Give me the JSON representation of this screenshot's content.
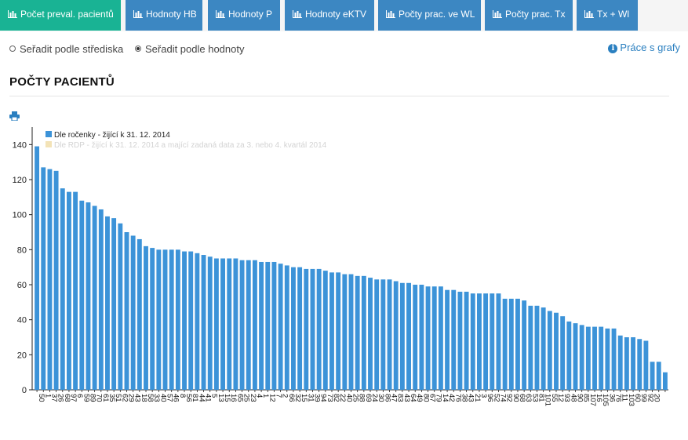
{
  "tabs": [
    {
      "label": "Počet preval. pacientů",
      "active": true,
      "icon": "bar-chart-icon"
    },
    {
      "label": "Hodnoty HB",
      "active": false,
      "icon": "bar-chart-icon"
    },
    {
      "label": "Hodnoty P",
      "active": false,
      "icon": "bar-chart-icon"
    },
    {
      "label": "Hodnoty eKTV",
      "active": false,
      "icon": "bar-chart-icon"
    },
    {
      "label": "Počty prac. ve WL",
      "active": false,
      "icon": "bar-chart-icon"
    },
    {
      "label": "Počty prac. Tx",
      "active": false,
      "icon": "bar-chart-icon"
    },
    {
      "label": "Tx + Wl",
      "active": false,
      "icon": "bar-chart-icon"
    }
  ],
  "sort": {
    "options": [
      {
        "label": "Seřadit podle střediska",
        "selected": false
      },
      {
        "label": "Seřadit podle hodnoty",
        "selected": true
      }
    ]
  },
  "help": {
    "label": "Práce s grafy",
    "icon": "info-icon"
  },
  "page_title": "POČTY PACIENTŮ",
  "print_icon": "printer-icon",
  "colors": {
    "tab_active": "#19b394",
    "tab_normal": "#3c87c2",
    "bar": "#3c93d8",
    "series2": "#f3e3b7",
    "link": "#2a7fc0"
  },
  "chart_data": {
    "type": "bar",
    "title": "",
    "xlabel": "",
    "ylabel": "",
    "ylim": [
      0,
      150
    ],
    "yticks": [
      0,
      20,
      40,
      60,
      80,
      100,
      120,
      140
    ],
    "grid": false,
    "legend_position": "top-left",
    "categories": [
      "50",
      "1",
      "37",
      "26",
      "68",
      "97",
      "6",
      "59",
      "89",
      "70",
      "61",
      "35",
      "51",
      "62",
      "29",
      "43",
      "18",
      "58",
      "33",
      "40",
      "57",
      "46",
      "8",
      "56",
      "81",
      "44",
      "41",
      "5",
      "13",
      "15",
      "16",
      "65",
      "25",
      "23",
      "4",
      "1",
      "12",
      "7",
      "2",
      "66",
      "32",
      "15",
      "31",
      "39",
      "94",
      "73",
      "82",
      "22",
      "40",
      "25",
      "88",
      "69",
      "24",
      "30",
      "86",
      "47",
      "83",
      "43",
      "64",
      "49",
      "80",
      "67",
      "79",
      "14",
      "42",
      "76",
      "38",
      "43",
      "21",
      "3",
      "96",
      "52",
      "74",
      "92",
      "90",
      "68",
      "63",
      "53",
      "81",
      "101",
      "55",
      "12",
      "93",
      "48",
      "90",
      "85",
      "107",
      "16",
      "105",
      "36",
      "76",
      "11",
      "103",
      "60",
      "99",
      "92",
      "20"
    ],
    "series": [
      {
        "name": "Dle ročenky - žijící k 31. 12. 2014",
        "values": [
          139,
          127,
          126,
          125,
          115,
          113,
          113,
          108,
          107,
          105,
          103,
          99,
          98,
          95,
          90,
          88,
          86,
          82,
          81,
          80,
          80,
          80,
          80,
          79,
          79,
          78,
          77,
          76,
          75,
          75,
          75,
          75,
          74,
          74,
          74,
          73,
          73,
          73,
          72,
          71,
          70,
          70,
          69,
          69,
          69,
          68,
          67,
          67,
          66,
          66,
          65,
          65,
          64,
          63,
          63,
          63,
          62,
          61,
          61,
          60,
          60,
          59,
          59,
          59,
          57,
          57,
          56,
          56,
          55,
          55,
          55,
          55,
          55,
          52,
          52,
          52,
          51,
          48,
          48,
          47,
          45,
          44,
          42,
          39,
          38,
          37,
          36,
          36,
          36,
          35,
          35,
          31,
          30,
          30,
          29,
          28,
          16,
          16,
          10
        ]
      },
      {
        "name": "Dle RDP - žijící k 31. 12. 2014 a mající zadaná data za 3. nebo 4. kvartál 2014",
        "values": []
      }
    ]
  }
}
